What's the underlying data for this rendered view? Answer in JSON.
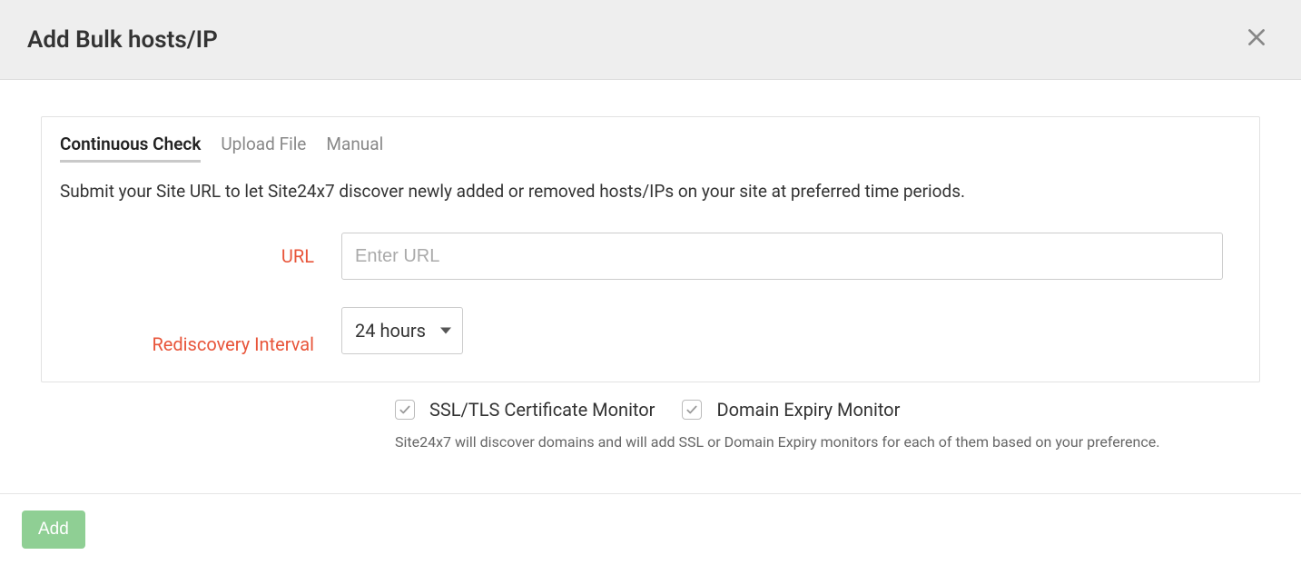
{
  "header": {
    "title": "Add Bulk hosts/IP"
  },
  "tabs": {
    "continuous": "Continuous Check",
    "upload": "Upload File",
    "manual": "Manual"
  },
  "description": "Submit your Site URL to let Site24x7 discover newly added or removed hosts/IPs on your site at preferred time periods.",
  "form": {
    "url_label": "URL",
    "url_placeholder": "Enter URL",
    "interval_label": "Rediscovery Interval",
    "interval_value": "24 hours"
  },
  "options": {
    "ssl_label": "SSL/TLS Certificate Monitor",
    "domain_label": "Domain Expiry Monitor",
    "hint": "Site24x7 will discover domains and will add SSL or Domain Expiry monitors for each of them based on your preference."
  },
  "footer": {
    "add_label": "Add"
  }
}
